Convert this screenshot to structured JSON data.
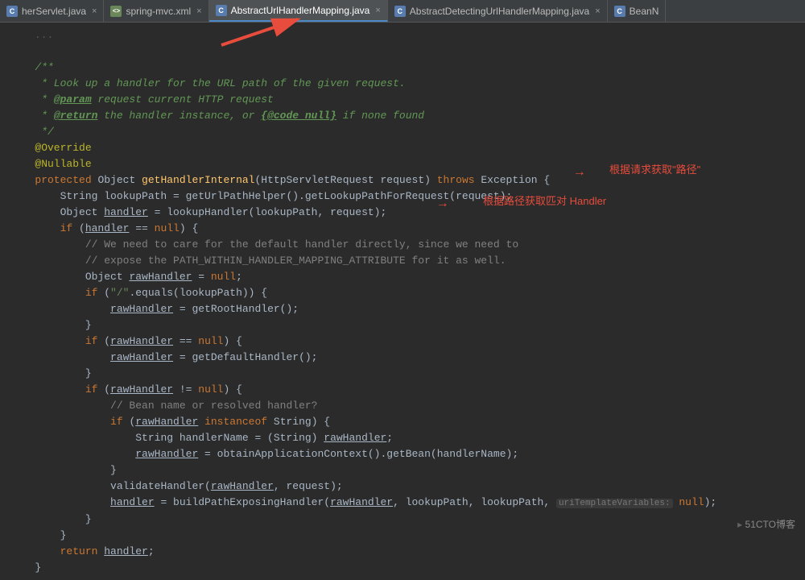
{
  "tabs": [
    {
      "label": "herServlet.java",
      "type": "java"
    },
    {
      "label": "spring-mvc.xml",
      "type": "xml"
    },
    {
      "label": "AbstractUrlHandlerMapping.java",
      "type": "java",
      "active": true
    },
    {
      "label": "AbstractDetectingUrlHandlerMapping.java",
      "type": "java"
    },
    {
      "label": "BeanN",
      "type": "java"
    }
  ],
  "annotations": {
    "a1": "根据请求获取\"路径\"",
    "a2": "根据路径获取匹对 Handler"
  },
  "watermark": "51CTO博客",
  "code": {
    "docL1": "/**",
    "docL2_pre": " * Look up a handler for the URL path of the given request.",
    "docL3_star": " * ",
    "docL3_tag": "@param",
    "docL3_rest": " request current HTTP request",
    "docL4_star": " * ",
    "docL4_tag": "@return",
    "docL4_rest": " the handler instance, or ",
    "docL4_code": "{@code null}",
    "docL4_rest2": " if none found",
    "docL5": " */",
    "ann1": "@Override",
    "ann2": "@Nullable",
    "kw_protected": "protected",
    "kw_Object": "Object ",
    "method_name": "getHandlerInternal",
    "sig_rest": "(HttpServletRequest request) ",
    "kw_throws": "throws",
    "sig_exc": " Exception {",
    "l1_a": "String lookupPath = getUrlPathHelper().getLookupPathForRequest(request);",
    "l2_a": "Object ",
    "l2_h": "handler",
    "l2_b": " = lookupHandler(lookupPath, request);",
    "l3_if": "if ",
    "l3_a": "(",
    "l3_h": "handler",
    "l3_b": " == ",
    "l3_null": "null",
    "l3_c": ") {",
    "c1": "// We need to care for the default handler directly, since we need to",
    "c2": "// expose the PATH_WITHIN_HANDLER_MAPPING_ATTRIBUTE for it as well.",
    "l4_a": "Object ",
    "l4_rh": "rawHandler",
    "l4_b": " = ",
    "l4_null": "null",
    "l4_c": ";",
    "l5_if": "if ",
    "l5_a": "(",
    "l5_str": "\"/\"",
    "l5_b": ".equals(lookupPath)) {",
    "l6_rh": "rawHandler",
    "l6_b": " = getRootHandler();",
    "brace": "}",
    "l7_if": "if ",
    "l7_a": "(",
    "l7_rh": "rawHandler",
    "l7_b": " == ",
    "l7_null": "null",
    "l7_c": ") {",
    "l8_rh": "rawHandler",
    "l8_b": " = getDefaultHandler();",
    "l9_if": "if ",
    "l9_a": "(",
    "l9_rh": "rawHandler",
    "l9_b": " != ",
    "l9_null": "null",
    "l9_c": ") {",
    "c3": "// Bean name or resolved handler?",
    "l10_if": "if ",
    "l10_a": "(",
    "l10_rh": "rawHandler",
    "l10_inst": " instanceof ",
    "l10_b": "String) {",
    "l11_a": "String handlerName = (String) ",
    "l11_rh": "rawHandler",
    "l11_b": ";",
    "l12_rh": "rawHandler",
    "l12_b": " = obtainApplicationContext().getBean(handlerName);",
    "l13_a": "validateHandler(",
    "l13_rh": "rawHandler",
    "l13_b": ", request);",
    "l14_h": "handler",
    "l14_a": " = buildPathExposingHandler(",
    "l14_rh": "rawHandler",
    "l14_b": ", lookupPath, lookupPath, ",
    "l14_hint": "uriTemplateVariables:",
    "l14_null": " null",
    "l14_c": ");",
    "ret_kw": "return ",
    "ret_h": "handler",
    "ret_b": ";"
  }
}
